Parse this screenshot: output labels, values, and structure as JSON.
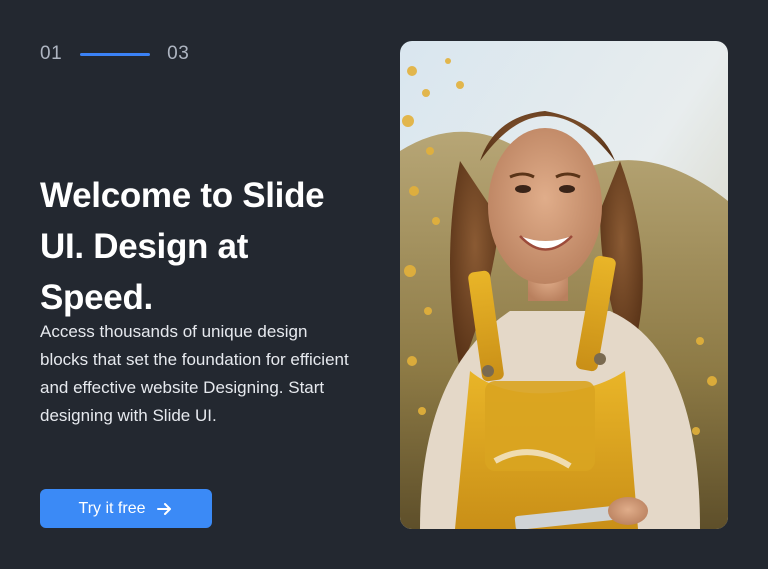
{
  "progress": {
    "current": "01",
    "total": "03"
  },
  "hero": {
    "title": "Welcome to Slide UI. Design at Speed.",
    "description": "Access thousands of unique design blocks that set the foundation for efficient and effective website Designing. Start designing with Slide UI.",
    "cta_label": "Try it free",
    "cta_icon": "arrow-right-icon"
  },
  "image": {
    "subject": "smiling-woman-yellow-overalls-photo"
  },
  "colors": {
    "background": "#232830",
    "accent": "#3b8af6",
    "muted_text": "#aeb5c1"
  }
}
